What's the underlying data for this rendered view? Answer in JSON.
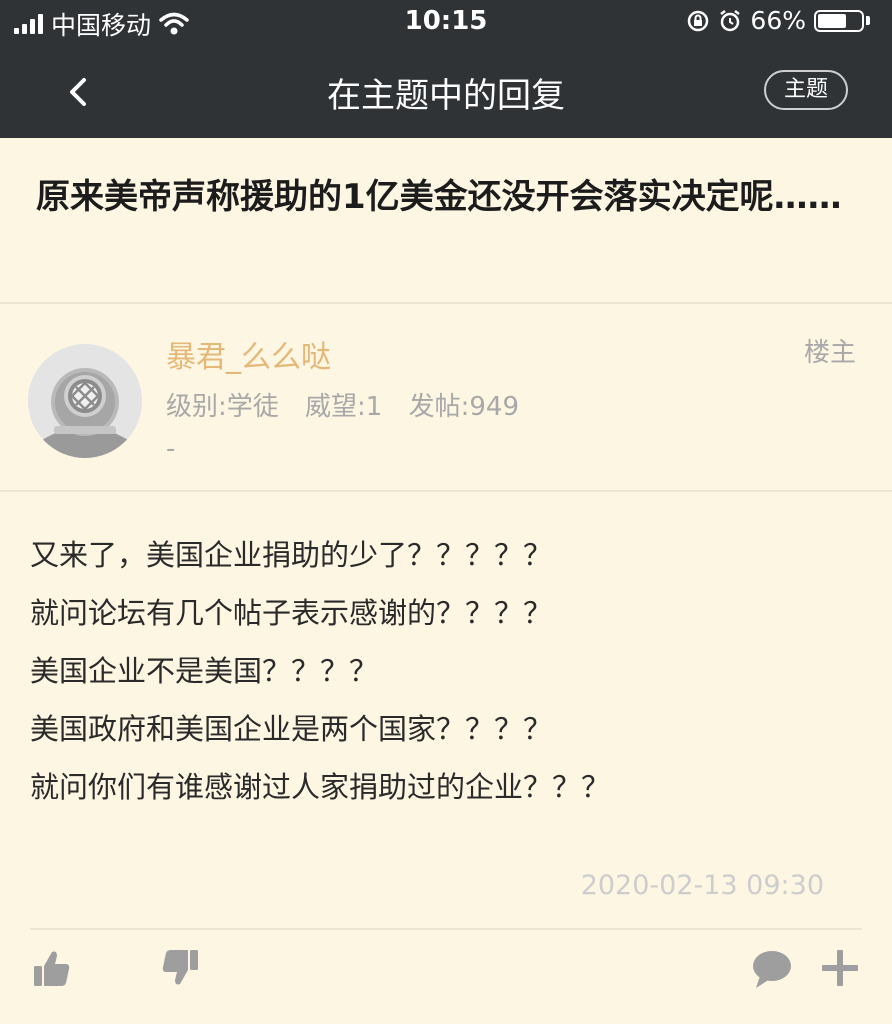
{
  "status_bar": {
    "carrier": "中国移动",
    "time": "10:15",
    "battery_percent": "66%",
    "battery_level": 0.66
  },
  "nav": {
    "title": "在主题中的回复",
    "topic_button": "主题"
  },
  "post": {
    "title": "原来美帝声称援助的1亿美金还没开会落实决定呢……",
    "author": {
      "name": "暴君_么么哒",
      "level": "级别:学徒",
      "prestige": "威望:1",
      "posts": "发帖:949",
      "signature": "-",
      "badge": "楼主"
    },
    "content_lines": [
      "又来了，美国企业捐助的少了？？？？？",
      "就问论坛有几个帖子表示感谢的？？？？",
      "美国企业不是美国？？？？",
      "美国政府和美国企业是两个国家？？？？",
      "就问你们有谁感谢过人家捐助过的企业？？？"
    ],
    "timestamp": "2020-02-13 09:30"
  },
  "actions": {
    "like_icon": "thumbs-up-icon",
    "dislike_icon": "thumbs-down-icon",
    "comment_icon": "comment-icon",
    "add_icon": "plus-icon"
  },
  "colors": {
    "bar_bg": "#2f3336",
    "page_bg": "#fdf6e3",
    "username": "#e5b878",
    "meta": "#a8a8a8",
    "icon": "#9e9e9e"
  }
}
